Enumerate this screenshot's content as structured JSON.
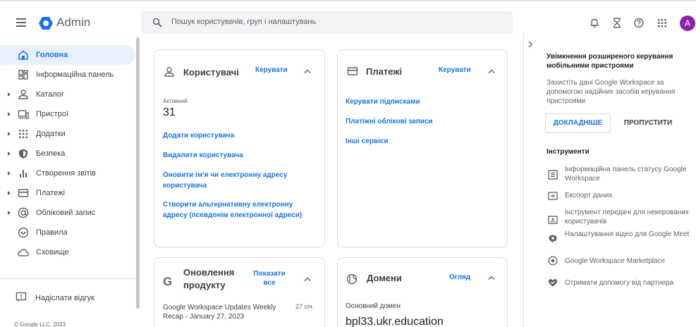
{
  "header": {
    "brand": "Admin",
    "search_placeholder": "Пошук користувачів, груп і налаштувань",
    "avatar_letter": "A",
    "brand_color": "#1a73e8",
    "avatar_color": "#8e24aa"
  },
  "sidebar": {
    "items": [
      {
        "label": "Головна",
        "icon": "home-icon",
        "active": true
      },
      {
        "label": "Інформаційна панель",
        "icon": "dashboard-icon"
      },
      {
        "label": "Каталог",
        "icon": "directory-icon"
      },
      {
        "label": "Пристрої",
        "icon": "devices-icon"
      },
      {
        "label": "Додатки",
        "icon": "apps-icon"
      },
      {
        "label": "Безпека",
        "icon": "shield-icon"
      },
      {
        "label": "Створення звітів",
        "icon": "reports-icon"
      },
      {
        "label": "Платежі",
        "icon": "billing-icon"
      },
      {
        "label": "Обліковий запис",
        "icon": "account-icon"
      },
      {
        "label": "Правила",
        "icon": "rules-icon"
      },
      {
        "label": "Сховище",
        "icon": "cloud-icon"
      }
    ],
    "feedback": "Надіслати відгук",
    "copyright": "© Google LLC, 2023"
  },
  "cards": {
    "users": {
      "title": "Користувачі",
      "action": "Керувати",
      "active_label": "Активний",
      "active_count": "31",
      "links": [
        "Додати користувача",
        "Видалити користувача",
        "Оновити ім'я чи електронну адресу користувача",
        "Створити альтернативну електронну адресу (псевдонім електронної адреси)"
      ]
    },
    "billing": {
      "title": "Платежі",
      "action": "Керувати",
      "links": [
        "Керувати підписками",
        "Платіжні облікові записи",
        "Інші сервіси"
      ]
    },
    "updates": {
      "title": "Оновлення продукту",
      "action": "Показати все",
      "item_text": "Google Workspace Updates Weekly Recap - January 27, 2023",
      "item_date": "27 січ."
    },
    "domains": {
      "title": "Домени",
      "action": "Огляд",
      "primary_label": "Основний домен",
      "primary_domain": "bpl33.ukr.education"
    }
  },
  "right_panel": {
    "promo_title": "Увімкнення розширеного керування мобільними пристроями",
    "promo_text": "Захистіть дані Google Workspace за допомогою надійних засобів керування пристроями",
    "learn_more": "ДОКЛАДНІШЕ",
    "skip": "ПРОПУСТИТИ",
    "tools_heading": "Інструменти",
    "tools": [
      {
        "label": "Інформаційна панель статусу Google Workspace",
        "icon": "status-dashboard-icon"
      },
      {
        "label": "Експорт даних",
        "icon": "export-icon"
      },
      {
        "label": "Інструмент передачі для некерованих користувачів",
        "icon": "transfer-icon"
      },
      {
        "label": "Налаштування відео для Google Meet",
        "icon": "meet-icon"
      },
      {
        "label": "Google Workspace Marketplace",
        "icon": "marketplace-icon"
      },
      {
        "label": "Отримати допомогу від партнера",
        "icon": "partner-icon"
      }
    ]
  }
}
